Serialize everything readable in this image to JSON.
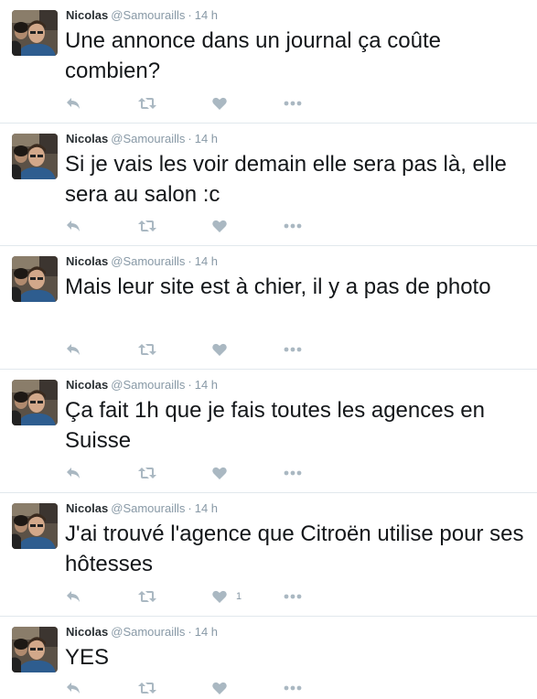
{
  "tweets": [
    {
      "name": "Nicolas",
      "handle": "@Samouraills",
      "separator": "·",
      "time": "14 h",
      "text": "Une annonce dans un journal ça coûte combien?",
      "like_count": ""
    },
    {
      "name": "Nicolas",
      "handle": "@Samouraills",
      "separator": "·",
      "time": "14 h",
      "text": "Si je vais les voir demain elle sera pas là, elle sera au salon :c",
      "like_count": ""
    },
    {
      "name": "Nicolas",
      "handle": "@Samouraills",
      "separator": "·",
      "time": "14 h",
      "text": "Mais leur site est à chier, il y a pas de photo",
      "like_count": ""
    },
    {
      "name": "Nicolas",
      "handle": "@Samouraills",
      "separator": "·",
      "time": "14 h",
      "text": "Ça fait 1h que je fais toutes les agences en Suisse",
      "like_count": ""
    },
    {
      "name": "Nicolas",
      "handle": "@Samouraills",
      "separator": "·",
      "time": "14 h",
      "text": "J'ai trouvé l'agence que Citroën utilise pour ses hôtesses",
      "like_count": "1"
    },
    {
      "name": "Nicolas",
      "handle": "@Samouraills",
      "separator": "·",
      "time": "14 h",
      "text": "YES",
      "like_count": ""
    }
  ],
  "icons": {
    "reply": "reply-icon",
    "retweet": "retweet-icon",
    "like": "heart-icon",
    "more": "more-icon"
  },
  "colors": {
    "icon": "#aab8c2",
    "muted": "#8899a6",
    "text": "#14171a",
    "divider": "#e1e8ed"
  }
}
